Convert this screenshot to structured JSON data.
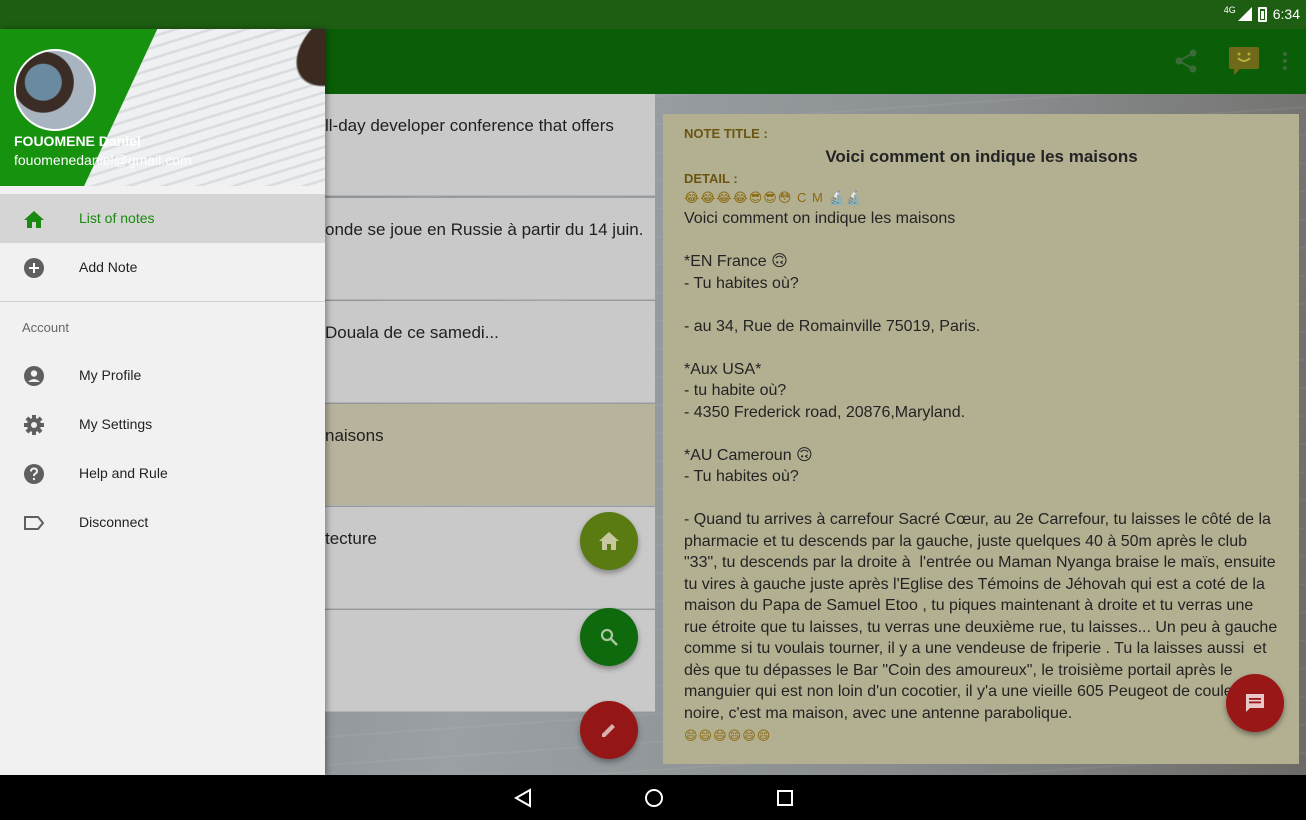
{
  "status": {
    "network": "4G",
    "time": "6:34"
  },
  "toolbar": {
    "icons": [
      "share-icon",
      "smiley-chat-icon",
      "more-vert-icon"
    ]
  },
  "notes": [
    {
      "text": "ll-day developer conference that offers"
    },
    {
      "text": "onde se joue en Russie à partir du 14 juin."
    },
    {
      "text": "Douala de ce samedi..."
    },
    {
      "text": "naisons",
      "selected": true
    },
    {
      "text": "tecture"
    },
    {
      "text": ""
    }
  ],
  "fabs": {
    "home": "home-icon",
    "search": "search-icon",
    "edit": "pencil-icon",
    "chat": "chat-icon"
  },
  "detail": {
    "title_label": "NOTE TITLE :",
    "title": "Voici comment on indique les maisons",
    "detail_label": "DETAIL :",
    "emoji_line": "😂😂😂😂😎😎😳 C M 🔬🔬",
    "body": "Voici comment on indique les maisons\n\n*EN France 🙃\n- Tu habites où?\n\n- au 34, Rue de Romainville 75019, Paris.\n\n*Aux USA*\n- tu habite où?\n- 4350 Frederick road, 20876,Maryland.\n\n*AU Cameroun 🙃\n- Tu habites où?\n\n- Quand tu arrives à carrefour Sacré Cœur, au 2e Carrefour, tu laisses le côté de la pharmacie et tu descends par la gauche, juste quelques 40 à 50m après le club \"33\", tu descends par la droite à  l'entrée ou Maman Nyanga braise le maïs, ensuite tu vires à gauche juste après l'Eglise des Témoins de Jéhovah qui est a coté de la maison du Papa de Samuel Etoo , tu piques maintenant à droite et tu verras une rue étroite que tu laisses, tu verras une deuxième rue, tu laisses... Un peu à gauche comme si tu voulais tourner, il y a une vendeuse de friperie . Tu la laisses aussi  et dès que tu dépasses le Bar \"Coin des amoureux\", le troisième portail après le manguier qui est non loin d'un cocotier, il y'a une vieille 605 Peugeot de couleur noire, c'est ma maison, avec une antenne parabolique.",
    "emoji_end": "😄😄😄😄😄😄"
  },
  "drawer": {
    "user_name": "FOUOMENE Daniel",
    "user_email": "fouomenedaniel@gmail.com",
    "items": [
      {
        "label": "List of notes",
        "icon": "home-icon",
        "active": true
      },
      {
        "label": "Add Note",
        "icon": "add-circle-icon"
      }
    ],
    "section_label": "Account",
    "account_items": [
      {
        "label": "My Profile",
        "icon": "account-circle-icon"
      },
      {
        "label": "My Settings",
        "icon": "gear-icon"
      },
      {
        "label": "Help and Rule",
        "icon": "help-icon"
      },
      {
        "label": "Disconnect",
        "icon": "label-icon"
      }
    ]
  },
  "colors": {
    "primary": "#0a5e07",
    "accent": "#16920f",
    "fab_red": "#9a1717"
  }
}
